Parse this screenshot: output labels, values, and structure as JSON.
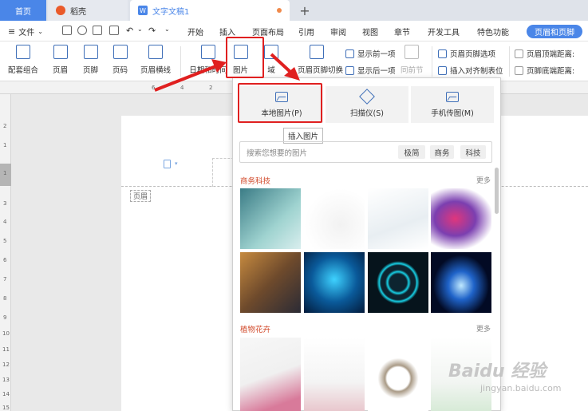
{
  "tabs": {
    "home": "首页",
    "daoke": "稻壳",
    "doc": "文字文稿1",
    "add": "+"
  },
  "menu": {
    "file": "文件",
    "items": [
      "开始",
      "插入",
      "页面布局",
      "引用",
      "审阅",
      "视图",
      "章节",
      "开发工具",
      "特色功能"
    ],
    "active": "页眉和页脚"
  },
  "ribbon": {
    "combo": "配套组合",
    "header": "页眉",
    "footer": "页脚",
    "page_number": "页码",
    "header_line": "页眉横线",
    "datetime": "日期和时间",
    "picture": "图片",
    "field": "域",
    "header_footer_switch": "页眉页脚切换",
    "show_prev": "显示前一项",
    "show_next": "显示后一项",
    "same_prev": "同前节",
    "hf_options": "页眉页脚选项",
    "insert_align_tab": "插入对齐制表位",
    "header_top_distance": "页眉顶端距离:",
    "footer_bottom_distance": "页脚底端距离:"
  },
  "ruler": {
    "top": [
      "6",
      "4",
      "2"
    ],
    "left": [
      "2",
      "1",
      "1",
      "3",
      "4",
      "5",
      "6",
      "7",
      "8",
      "9",
      "10",
      "11",
      "12",
      "13",
      "14",
      "15"
    ]
  },
  "document": {
    "header_tag": "页眉"
  },
  "picture_panel": {
    "local_picture": "本地图片(P)",
    "scanner": "扫描仪(S)",
    "phone_transfer": "手机传图(M)",
    "tooltip": "插入图片",
    "search_placeholder": "搜索您想要的图片",
    "tags": [
      "极简",
      "商务",
      "科技"
    ],
    "category1": "商务科技",
    "category2": "植物花卉",
    "more": "更多"
  },
  "watermark": {
    "brand": "Baidu 经验",
    "url": "jingyan.baidu.com"
  },
  "colors": {
    "accent": "#4a86e8",
    "highlight": "#e02020",
    "category": "#d24a2b"
  }
}
